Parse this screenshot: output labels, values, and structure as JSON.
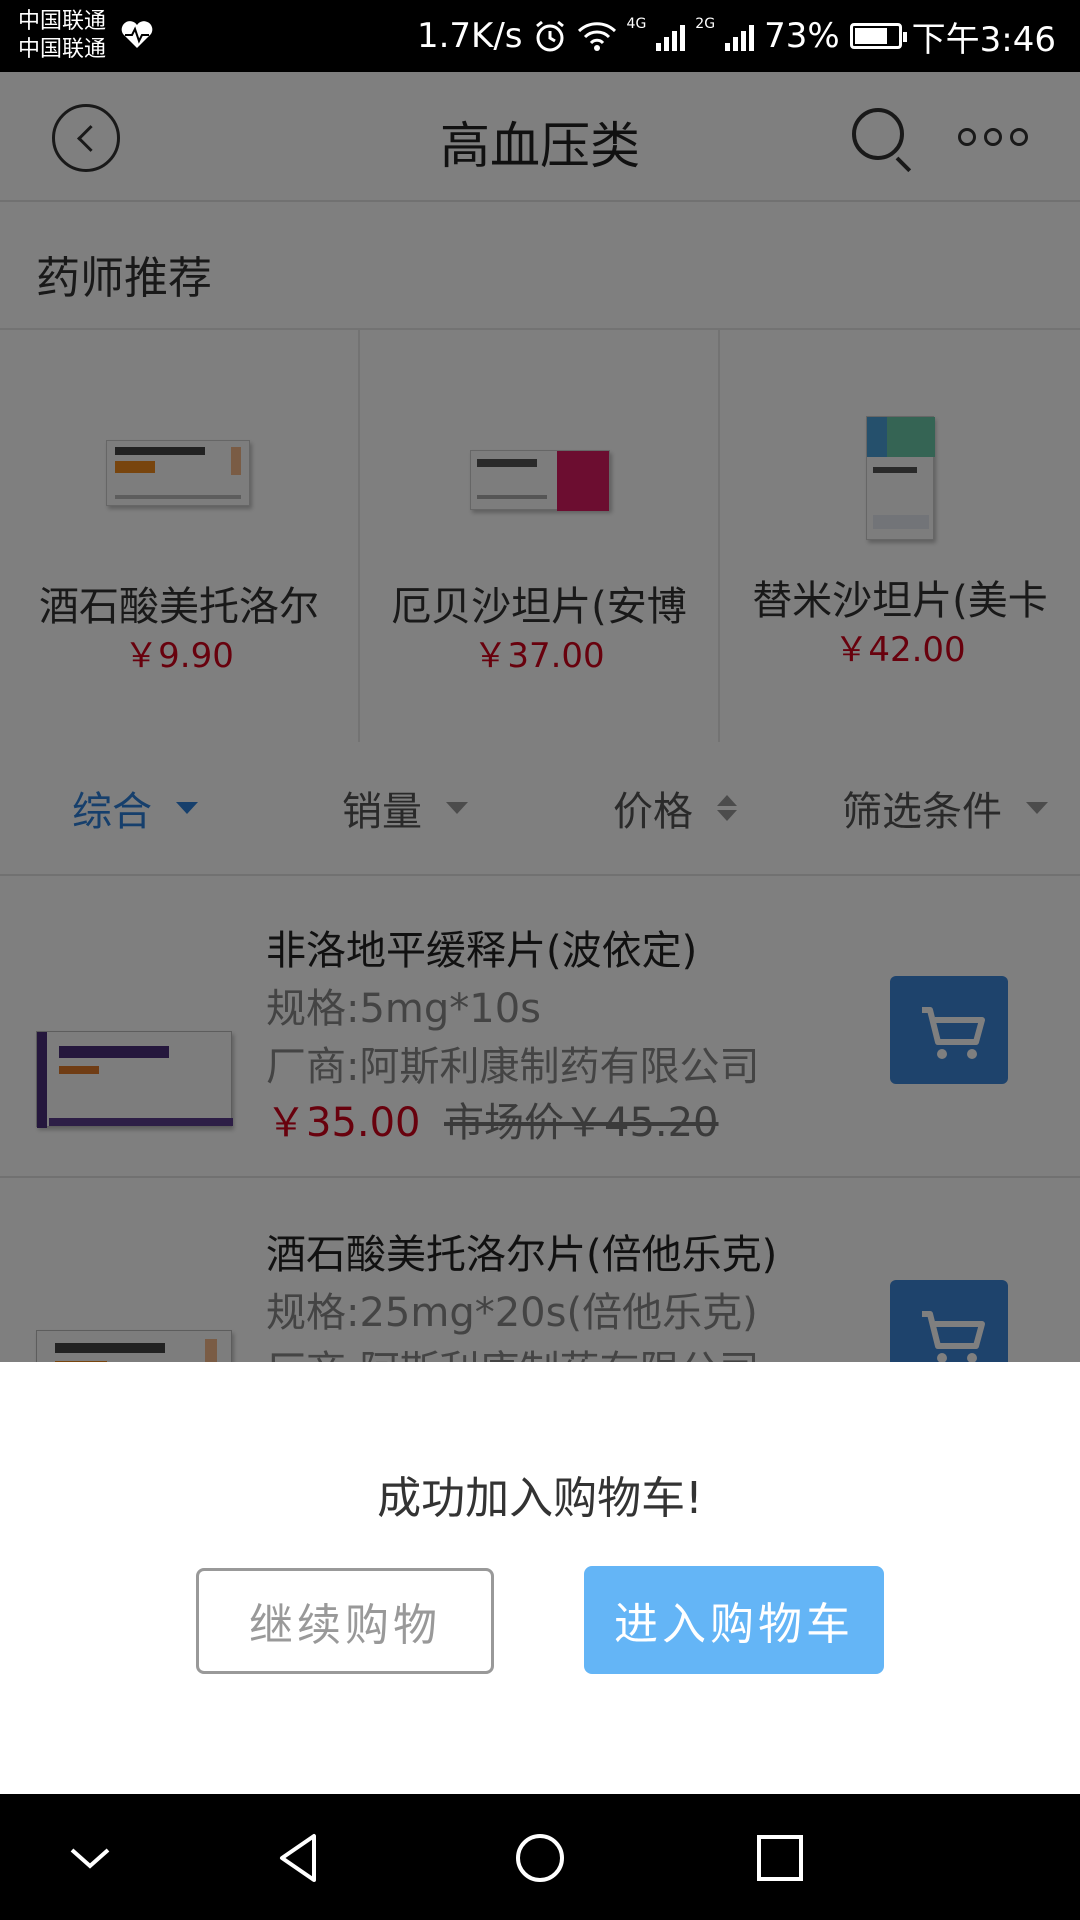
{
  "status_bar": {
    "carrier_1": "中国联通",
    "carrier_2": "中国联通",
    "net_speed": "1.7K/s",
    "net_4g": "4G",
    "net_2g": "2G",
    "battery": "73%",
    "battery_level": 0.73,
    "time": "下午3:46"
  },
  "header": {
    "title": "高血压类"
  },
  "recommend": {
    "title": "药师推荐",
    "items": [
      {
        "name": "酒石酸美托洛尔",
        "price": "￥9.90"
      },
      {
        "name": "厄贝沙坦片(安博",
        "price": "￥37.00"
      },
      {
        "name": "替米沙坦片(美卡",
        "price": "￥42.00"
      }
    ]
  },
  "filters": [
    {
      "label": "综合",
      "active": true
    },
    {
      "label": "销量"
    },
    {
      "label": "价格"
    },
    {
      "label": "筛选条件"
    }
  ],
  "products": [
    {
      "name": "非洛地平缓释片(波依定)",
      "spec": "规格:5mg*10s",
      "maker": "厂商:阿斯利康制药有限公司",
      "price": "￥35.00",
      "market_price": "市场价￥45.20"
    },
    {
      "name": "酒石酸美托洛尔片(倍他乐克)",
      "spec": "规格:25mg*20s(倍他乐克)",
      "maker": "厂商:阿斯利康制药有限公司"
    }
  ],
  "dialog": {
    "message": "成功加入购物车!",
    "continue_label": "继续购物",
    "go_cart_label": "进入购物车"
  },
  "colors": {
    "accent_blue": "#2d7fd8",
    "price_red": "#d0021b",
    "cart_button": "#3d86d9",
    "dialog_primary": "#64b5f6"
  },
  "icons": {
    "back": "back-arrow-circle-icon",
    "search": "search-icon",
    "more": "more-dots-icon",
    "cart": "cart-icon",
    "nav_down": "chevron-down-icon",
    "nav_back": "triangle-back-icon",
    "nav_home": "circle-home-icon",
    "nav_recent": "square-recent-icon"
  }
}
